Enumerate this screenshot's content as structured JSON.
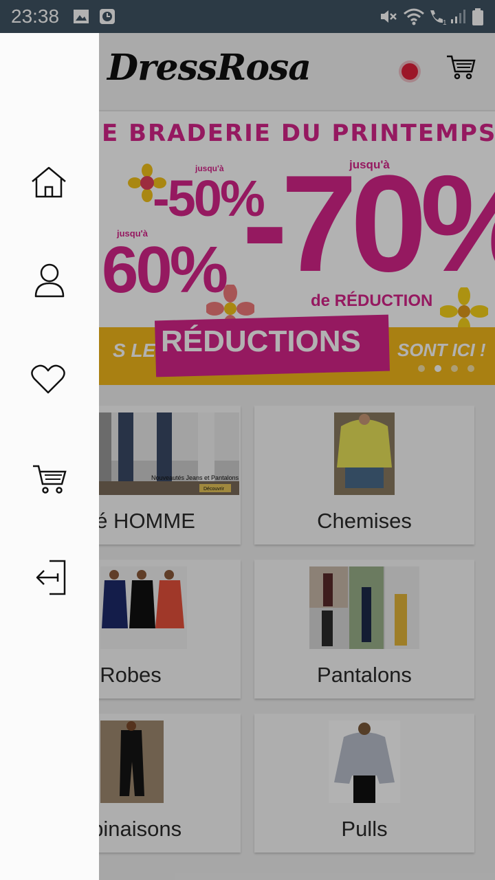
{
  "status_bar": {
    "time": "23:38",
    "icons": [
      "gallery-icon",
      "clock-icon",
      "mute-icon",
      "wifi-icon",
      "wifi-call-icon",
      "signal-icon",
      "battery-icon"
    ]
  },
  "header": {
    "logo_text": "DressRosa",
    "cart_icon": "cart-icon",
    "indicator_color": "#e0203a"
  },
  "banner": {
    "headline": "E BRADERIE DU PRINTEMPS !",
    "upto_small": "jusqu'à",
    "upto_large": "jusqu'à",
    "upto_left": "jusqu'à",
    "percent_50": "-50%",
    "percent_70": "-70%",
    "percent_60": "60%",
    "reduction_text": "de RÉDUCTION",
    "les": "S LES",
    "reductions": "RÉDUCTIONS",
    "sont_ici": "SONT ICI !",
    "slide_count": 4,
    "active_slide": 2,
    "colors": {
      "accent": "#d6248a",
      "bar": "#f2b81b"
    }
  },
  "categories": [
    {
      "label": "auté HOMME",
      "thumb_caption": "Nouveautés Jeans et Pantalons",
      "thumb_button": "Découvrir"
    },
    {
      "label": "Chemises"
    },
    {
      "label": "Robes"
    },
    {
      "label": "Pantalons"
    },
    {
      "label": "nbinaisons"
    },
    {
      "label": "Pulls"
    }
  ],
  "drawer": {
    "items": [
      {
        "icon": "home-icon"
      },
      {
        "icon": "user-icon"
      },
      {
        "icon": "heart-icon"
      },
      {
        "icon": "cart-icon"
      },
      {
        "icon": "logout-icon"
      }
    ]
  }
}
